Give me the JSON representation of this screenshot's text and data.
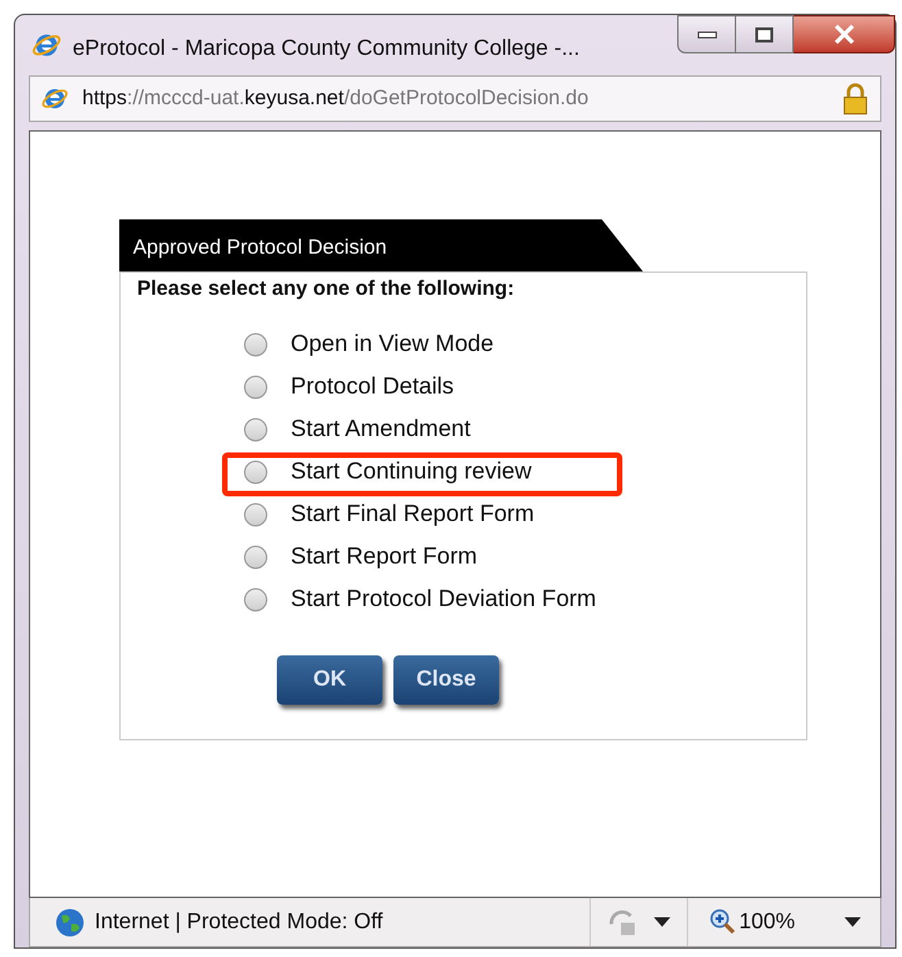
{
  "window": {
    "title": "eProtocol - Maricopa County Community College -..."
  },
  "address_bar": {
    "url": "**https**://mcccd-uat.**keyusa.net**/doGetProtocolDecision.do"
  },
  "dialog": {
    "title": "Approved Protocol Decision",
    "prompt": "Please select any one of the following:",
    "options": [
      {
        "label": "Open in View Mode",
        "selected": false,
        "highlighted": false
      },
      {
        "label": "Protocol Details",
        "selected": false,
        "highlighted": false
      },
      {
        "label": "Start Amendment",
        "selected": false,
        "highlighted": false
      },
      {
        "label": "Start Continuing review",
        "selected": false,
        "highlighted": true
      },
      {
        "label": "Start Final Report Form",
        "selected": false,
        "highlighted": false
      },
      {
        "label": "Start Report Form",
        "selected": false,
        "highlighted": false
      },
      {
        "label": "Start Protocol Deviation Form",
        "selected": false,
        "highlighted": false
      }
    ],
    "buttons": [
      "OK",
      "Close"
    ]
  },
  "status_bar": {
    "zone": "Internet | Protected Mode: Off",
    "zoom": "100%"
  }
}
